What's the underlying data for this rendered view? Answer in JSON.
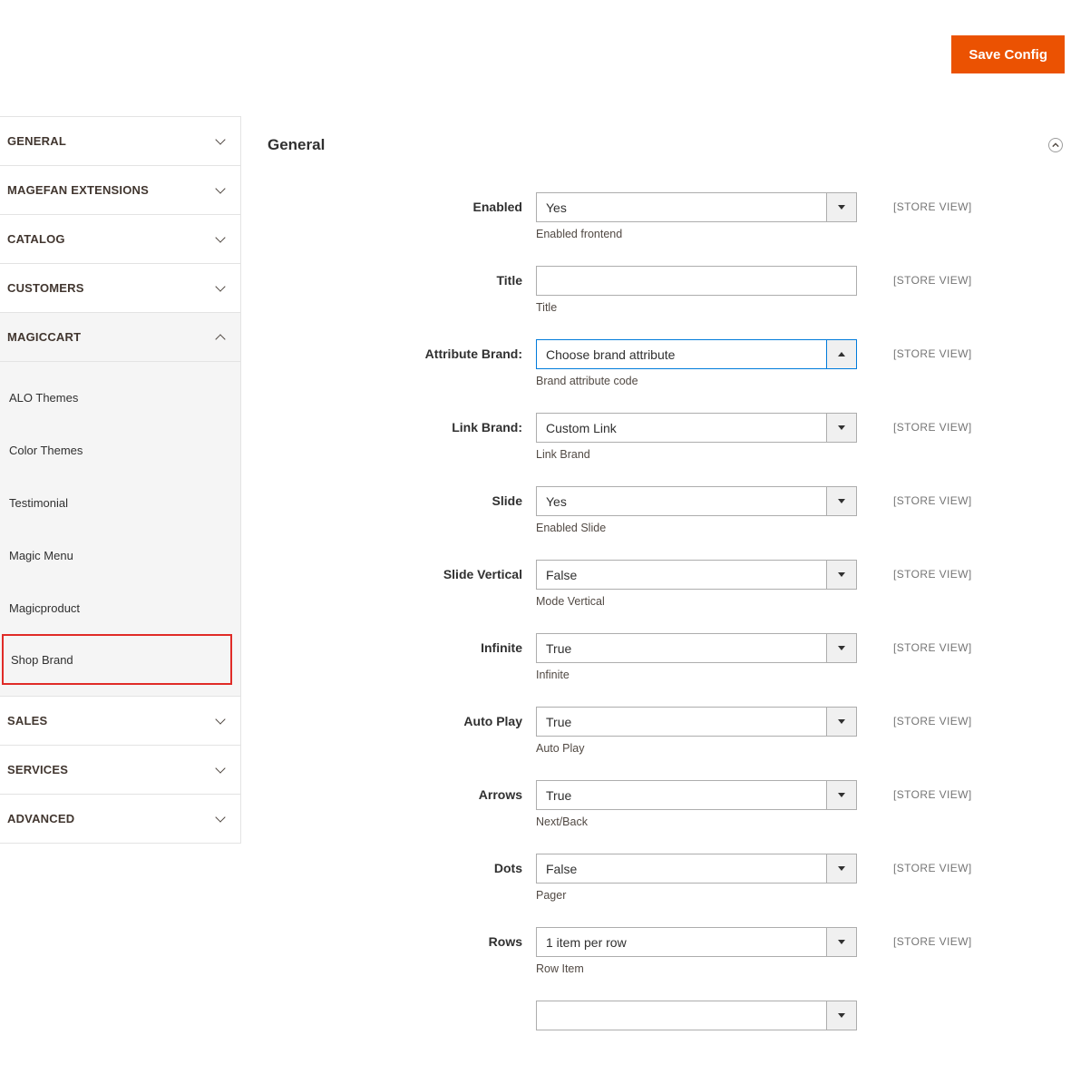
{
  "header": {
    "save_button_label": "Save Config"
  },
  "sidebar": {
    "sections": [
      {
        "label": "GENERAL",
        "expanded": false
      },
      {
        "label": "MAGEFAN EXTENSIONS",
        "expanded": false
      },
      {
        "label": "CATALOG",
        "expanded": false
      },
      {
        "label": "CUSTOMERS",
        "expanded": false
      },
      {
        "label": "MAGICCART",
        "expanded": true,
        "items": [
          {
            "label": "ALO Themes",
            "selected": false
          },
          {
            "label": "Color Themes",
            "selected": false
          },
          {
            "label": "Testimonial",
            "selected": false
          },
          {
            "label": "Magic Menu",
            "selected": false
          },
          {
            "label": "Magicproduct",
            "selected": false
          },
          {
            "label": "Shop Brand",
            "selected": true
          }
        ]
      },
      {
        "label": "SALES",
        "expanded": false
      },
      {
        "label": "SERVICES",
        "expanded": false
      },
      {
        "label": "ADVANCED",
        "expanded": false
      }
    ]
  },
  "main": {
    "section_title": "General",
    "fields": [
      {
        "label": "Enabled",
        "type": "select",
        "value": "Yes",
        "comment": "Enabled frontend",
        "scope": "[STORE VIEW]",
        "focused": false,
        "open": false
      },
      {
        "label": "Title",
        "type": "text",
        "value": "",
        "comment": "Title",
        "scope": "[STORE VIEW]",
        "focused": false,
        "open": false
      },
      {
        "label": "Attribute Brand:",
        "type": "select",
        "value": "Choose brand attribute",
        "comment": "Brand attribute code",
        "scope": "[STORE VIEW]",
        "focused": true,
        "open": true
      },
      {
        "label": "Link Brand:",
        "type": "select",
        "value": "Custom Link",
        "comment": "Link Brand",
        "scope": "[STORE VIEW]",
        "focused": false,
        "open": false
      },
      {
        "label": "Slide",
        "type": "select",
        "value": "Yes",
        "comment": "Enabled Slide",
        "scope": "[STORE VIEW]",
        "focused": false,
        "open": false
      },
      {
        "label": "Slide Vertical",
        "type": "select",
        "value": "False",
        "comment": "Mode Vertical",
        "scope": "[STORE VIEW]",
        "focused": false,
        "open": false
      },
      {
        "label": "Infinite",
        "type": "select",
        "value": "True",
        "comment": "Infinite",
        "scope": "[STORE VIEW]",
        "focused": false,
        "open": false
      },
      {
        "label": "Auto Play",
        "type": "select",
        "value": "True",
        "comment": "Auto Play",
        "scope": "[STORE VIEW]",
        "focused": false,
        "open": false
      },
      {
        "label": "Arrows",
        "type": "select",
        "value": "True",
        "comment": "Next/Back",
        "scope": "[STORE VIEW]",
        "focused": false,
        "open": false
      },
      {
        "label": "Dots",
        "type": "select",
        "value": "False",
        "comment": "Pager",
        "scope": "[STORE VIEW]",
        "focused": false,
        "open": false
      },
      {
        "label": "Rows",
        "type": "select",
        "value": "1 item per row",
        "comment": "Row Item",
        "scope": "[STORE VIEW]",
        "focused": false,
        "open": false
      },
      {
        "label": "",
        "type": "select",
        "value": "",
        "comment": "",
        "scope": "",
        "focused": false,
        "open": false,
        "partial": true
      }
    ]
  },
  "icons": {
    "section_chevron_collapsed": "chevron-down",
    "section_chevron_expanded": "chevron-up",
    "panel_collapse": "chevron-up-circle",
    "select_caret_closed": "caret-down",
    "select_caret_open": "caret-up"
  },
  "colors": {
    "accent": "#eb5202",
    "focus_border": "#007bdb",
    "selected_outline": "#e02b27",
    "row_border": "#e3e3e3",
    "input_border": "#adadad"
  }
}
